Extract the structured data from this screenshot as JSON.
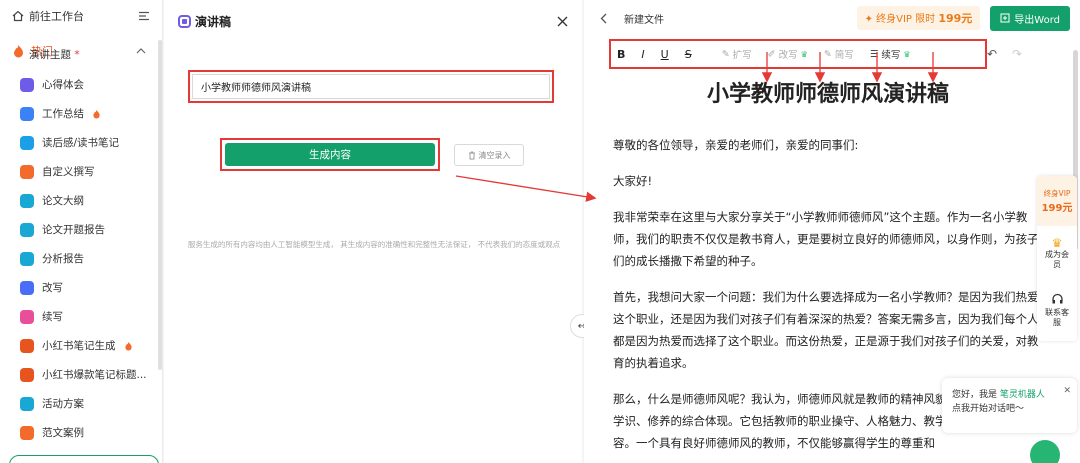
{
  "sidebar": {
    "back_label": "前往工作台",
    "section_label": "热门",
    "items": [
      {
        "label": "心得体会",
        "color": "#6c5ce7",
        "icon": "note-icon"
      },
      {
        "label": "工作总结",
        "color": "#3b82f6",
        "icon": "briefcase-icon",
        "hot": true
      },
      {
        "label": "读后感/读书笔记",
        "color": "#1ba0e8",
        "icon": "book-icon"
      },
      {
        "label": "自定义撰写",
        "color": "#f36a2b",
        "icon": "fire-icon"
      },
      {
        "label": "论文大纲",
        "color": "#19a8d4",
        "icon": "outline-icon"
      },
      {
        "label": "论文开题报告",
        "color": "#19a8d4",
        "icon": "report-icon"
      },
      {
        "label": "分析报告",
        "color": "#19a8d4",
        "icon": "chart-icon"
      },
      {
        "label": "改写",
        "color": "#4a6cf7",
        "icon": "rewrite-icon"
      },
      {
        "label": "续写",
        "color": "#e94e9a",
        "icon": "continue-icon"
      },
      {
        "label": "小红书笔记生成",
        "color": "#e8541e",
        "icon": "xhs-icon",
        "hot": true
      },
      {
        "label": "小红书爆款笔记标题...",
        "color": "#e8541e",
        "icon": "xhs-icon"
      },
      {
        "label": "活动方案",
        "color": "#19a8d4",
        "icon": "plan-icon"
      },
      {
        "label": "范文案例",
        "color": "#f36a2b",
        "icon": "fire-icon"
      }
    ]
  },
  "middle": {
    "title": "演讲稿",
    "field_label": "演讲主题",
    "required_mark": "*",
    "topic_value": "小学教师师德师风演讲稿",
    "generate_label": "生成内容",
    "clear_label": "清空录入",
    "disclaimer": "服务生成的所有内容均由人工智能模型生成， 其生成内容的准确性和完整性无法保证， 不代表我们的态度或观点"
  },
  "right": {
    "doc_name": "新建文件",
    "vip_prefix": "终身VIP 限时",
    "vip_price": "199元",
    "export_label": "导出Word",
    "toolbar": {
      "bold": "B",
      "italic": "I",
      "underline": "U",
      "strike": "S",
      "expand": "扩写",
      "rewrite": "改写",
      "shorten": "简写",
      "continue": "续写"
    },
    "document": {
      "title": "小学教师师德师风演讲稿",
      "paragraphs": [
        "尊敬的各位领导，亲爱的老师们，亲爱的同事们:",
        "大家好!",
        "我非常荣幸在这里与大家分享关于“小学教师师德师风”这个主题。作为一名小学教师，我们的职责不仅仅是教书育人，更是要树立良好的师德师风，以身作则，为孩子们的成长播撒下希望的种子。",
        "首先，我想问大家一个问题：我们为什么要选择成为一名小学教师？是因为我们热爱这个职业，还是因为我们对孩子们有着深深的热爱？答案无需多言，因为我们每个人都是因为热爱而选择了这个职业。而这份热爱，正是源于我们对孩子们的关爱，对教育的执着追求。",
        "那么，什么是师德师风呢？我认为，师德师风就是教师的精神风貌，是教师的素质、学识、修养的综合体现。它包括教师的职业操守、人格魅力、教学能力等多方面的内容。一个具有良好师德师风的教师，不仅能够赢得学生的尊重和"
      ]
    }
  },
  "float_bar": {
    "vip_label": "终身VIP",
    "vip_price": "199元",
    "member_label": "成为会员",
    "service_label": "联系客服"
  },
  "chat": {
    "greeting_prefix": "您好，我是",
    "bot_name": "笔灵机器人",
    "greeting_line2": "点我开始对话吧～"
  }
}
